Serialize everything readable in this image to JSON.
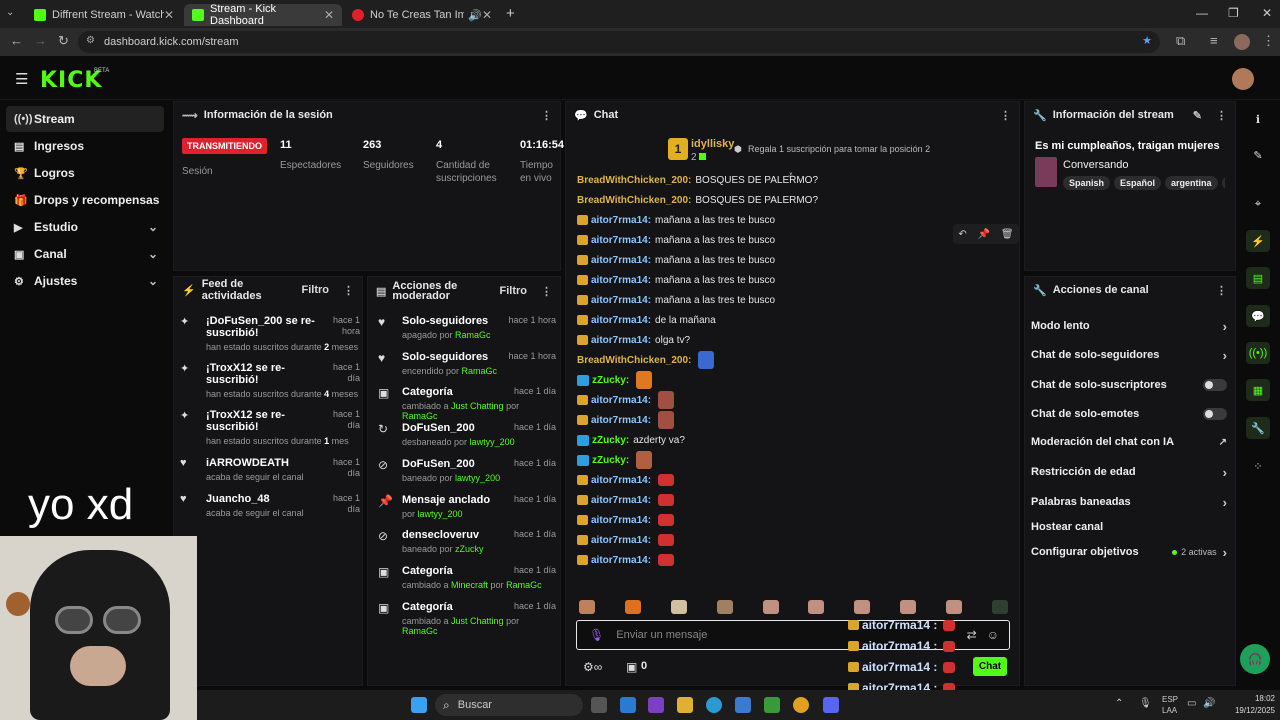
{
  "browser": {
    "tabs": [
      {
        "title": "Diffrent Stream - Watch Live on",
        "active": false
      },
      {
        "title": "Stream - Kick Dashboard",
        "active": true
      },
      {
        "title": "No Te Creas Tan Importante",
        "active": false
      }
    ],
    "url": "dashboard.kick.com/stream"
  },
  "header": {
    "logo": "KICK",
    "beta": "BETA"
  },
  "sidebar": {
    "items": [
      {
        "label": "Stream",
        "icon": "stream-icon",
        "selected": true
      },
      {
        "label": "Ingresos",
        "icon": "revenue-icon"
      },
      {
        "label": "Logros",
        "icon": "trophy-icon"
      },
      {
        "label": "Drops y recompensas",
        "icon": "drops-icon"
      },
      {
        "label": "Estudio",
        "icon": "studio-icon",
        "expandable": true
      },
      {
        "label": "Canal",
        "icon": "channel-icon",
        "expandable": true
      },
      {
        "label": "Ajustes",
        "icon": "settings-icon",
        "expandable": true
      }
    ]
  },
  "session": {
    "title": "Información de la sesión",
    "live_badge": "TRANSMITIENDO",
    "session_label": "Sesión",
    "stats": [
      {
        "value": "11",
        "label": "Espectadores"
      },
      {
        "value": "263",
        "label": "Seguidores"
      },
      {
        "value": "4",
        "label": "Cantidad de suscripciones"
      },
      {
        "value": "01:16:54",
        "label": "Tiempo en vivo"
      }
    ]
  },
  "feed": {
    "title": "Feed de actividades",
    "filter": "Filtro",
    "items": [
      {
        "title": "¡DoFuSen_200 se re-suscribió!",
        "time": "hace 1 hora",
        "sub_pre": "han estado suscritos durante ",
        "sub_hl": "2",
        "sub_post": " meses"
      },
      {
        "title": "¡TroxX12 se re-suscribió!",
        "time": "hace 1 día",
        "sub_pre": "han estado suscritos durante ",
        "sub_hl": "4",
        "sub_post": " meses"
      },
      {
        "title": "¡TroxX12 se re-suscribió!",
        "time": "hace 1 día",
        "sub_pre": "han estado suscritos durante ",
        "sub_hl": "1",
        "sub_post": " mes"
      },
      {
        "title": "iARROWDEATH",
        "time": "hace 1 día",
        "sub_pre": "acaba de seguir el canal",
        "sub_hl": "",
        "sub_post": ""
      },
      {
        "title": "Juancho_48",
        "time": "hace 1 día",
        "sub_pre": "acaba de seguir el canal",
        "sub_hl": "",
        "sub_post": ""
      }
    ]
  },
  "mod": {
    "title": "Acciones de moderador",
    "filter": "Filtro",
    "items": [
      {
        "title": "Solo-seguidores",
        "time": "hace 1 hora",
        "pre": "apagado por ",
        "hl": "RamaGc",
        "mid": "",
        "hl2": "",
        "icon": "heart-icon"
      },
      {
        "title": "Solo-seguidores",
        "time": "hace 1 hora",
        "pre": "encendido por ",
        "hl": "RamaGc",
        "mid": "",
        "hl2": "",
        "icon": "heart-icon"
      },
      {
        "title": "Categoría",
        "time": "hace 1 día",
        "pre": "cambiado a ",
        "hl": "Just Chatting",
        "mid": " por ",
        "hl2": "RamaGc",
        "icon": "category-icon"
      },
      {
        "title": "DoFuSen_200",
        "time": "hace 1 día",
        "pre": "desbaneado por ",
        "hl": "lawtyy_200",
        "mid": "",
        "hl2": "",
        "icon": "unban-icon"
      },
      {
        "title": "DoFuSen_200",
        "time": "hace 1 día",
        "pre": "baneado por ",
        "hl": "lawtyy_200",
        "mid": "",
        "hl2": "",
        "icon": "ban-icon"
      },
      {
        "title": "Mensaje anclado",
        "time": "hace 1 día",
        "pre": "por ",
        "hl": "lawtyy_200",
        "mid": "",
        "hl2": "",
        "icon": "pin-icon"
      },
      {
        "title": "densecloveruv",
        "time": "hace 1 día",
        "pre": "baneado por ",
        "hl": "zZucky",
        "mid": "",
        "hl2": "",
        "icon": "ban-icon"
      },
      {
        "title": "Categoría",
        "time": "hace 1 día",
        "pre": "cambiado a ",
        "hl": "Minecraft",
        "mid": " por ",
        "hl2": "RamaGc",
        "icon": "category-icon"
      },
      {
        "title": "Categoría",
        "time": "hace 1 día",
        "pre": "cambiado a ",
        "hl": "Just Chatting",
        "mid": " por ",
        "hl2": "RamaGc",
        "icon": "category-icon"
      }
    ]
  },
  "chat": {
    "title": "Chat",
    "top_user": "idyllisky",
    "top_rank": "1",
    "top_count": "2",
    "gift_text": "Regala 1 suscripción para tomar la posición 2",
    "messages": [
      {
        "user": "BreadWithChicken_200:",
        "text": "BOSQUES DE PALERMO?",
        "badge": "",
        "color": "#e0b44a"
      },
      {
        "user": "BreadWithChicken_200:",
        "text": "BOSQUES DE PALERMO?",
        "badge": "",
        "color": "#e0b44a"
      },
      {
        "user": "aitor7rma14:",
        "text": "mañana a las tres te busco",
        "badge": "crown",
        "color": "#8ec7ff"
      },
      {
        "user": "aitor7rma14:",
        "text": "mañana a las tres te busco",
        "badge": "crown",
        "color": "#8ec7ff"
      },
      {
        "user": "aitor7rma14:",
        "text": "mañana a las tres te busco",
        "badge": "crown",
        "color": "#8ec7ff"
      },
      {
        "user": "aitor7rma14:",
        "text": "mañana a las tres te busco",
        "badge": "crown",
        "color": "#8ec7ff"
      },
      {
        "user": "aitor7rma14:",
        "text": "mañana a las tres te busco",
        "badge": "crown",
        "color": "#8ec7ff"
      },
      {
        "user": "aitor7rma14:",
        "text": "de la mañana",
        "badge": "crown",
        "color": "#8ec7ff"
      },
      {
        "user": "aitor7rma14:",
        "text": "olga tv?",
        "badge": "crown",
        "color": "#8ec7ff"
      },
      {
        "user": "BreadWithChicken_200:",
        "text": "",
        "badge": "",
        "color": "#e0b44a",
        "emote": "#3a6ad0"
      },
      {
        "user": "zZucky:",
        "text": "",
        "badge": "vip",
        "color": "#53fc18",
        "emote": "#e07820"
      },
      {
        "user": "aitor7rma14:",
        "text": "",
        "badge": "crown",
        "color": "#8ec7ff",
        "emote": "#a05040"
      },
      {
        "user": "aitor7rma14:",
        "text": "",
        "badge": "crown",
        "color": "#8ec7ff",
        "emote": "#a05040"
      },
      {
        "user": "zZucky:",
        "text": "azderty va?",
        "badge": "vip",
        "color": "#53fc18"
      },
      {
        "user": "zZucky:",
        "text": "",
        "badge": "vip",
        "color": "#53fc18",
        "emote": "#b06040"
      },
      {
        "user": "aitor7rma14:",
        "text": "",
        "badge": "crown",
        "color": "#8ec7ff",
        "emote": "#d03030"
      },
      {
        "user": "aitor7rma14:",
        "text": "",
        "badge": "crown",
        "color": "#8ec7ff",
        "emote": "#d03030"
      },
      {
        "user": "aitor7rma14:",
        "text": "",
        "badge": "crown",
        "color": "#8ec7ff",
        "emote": "#d03030"
      },
      {
        "user": "aitor7rma14:",
        "text": "",
        "badge": "crown",
        "color": "#8ec7ff",
        "emote": "#d03030"
      },
      {
        "user": "aitor7rma14:",
        "text": "",
        "badge": "crown",
        "color": "#8ec7ff",
        "emote": "#d03030"
      }
    ],
    "input_placeholder": "Enviar un mensaje",
    "send_label": "Chat",
    "points": "0",
    "overlay_user": "aitor7rma14 :"
  },
  "stream_info": {
    "title": "Información del stream",
    "stream_title": "Es mi cumpleaños, traigan mujeres",
    "category": "Conversando",
    "tags": [
      "Spanish",
      "Español",
      "argentina",
      "ch"
    ]
  },
  "channel_actions": {
    "title": "Acciones de canal",
    "items": [
      {
        "label": "Modo lento",
        "type": "arrow"
      },
      {
        "label": "Chat de solo-seguidores",
        "type": "arrow"
      },
      {
        "label": "Chat de solo-suscriptores",
        "type": "toggle"
      },
      {
        "label": "Chat de solo-emotes",
        "type": "toggle"
      },
      {
        "label": "Moderación del chat con IA",
        "type": "external"
      },
      {
        "label": "Restricción de edad",
        "type": "arrow"
      },
      {
        "label": "Palabras baneadas",
        "type": "arrow"
      },
      {
        "label": "Hostear canal",
        "type": "none"
      },
      {
        "label": "Configurar objetivos",
        "type": "arrow",
        "badge": "2 activas"
      }
    ]
  },
  "overlay": {
    "webcam_text": "yo xd"
  },
  "taskbar": {
    "search": "Buscar",
    "lang": "ESP",
    "lang2": "LAA",
    "time": "18:02",
    "date": "19/12/2025"
  },
  "colors": {
    "accent": "#53fc18",
    "live": "#e0202a",
    "panel": "#141416"
  }
}
